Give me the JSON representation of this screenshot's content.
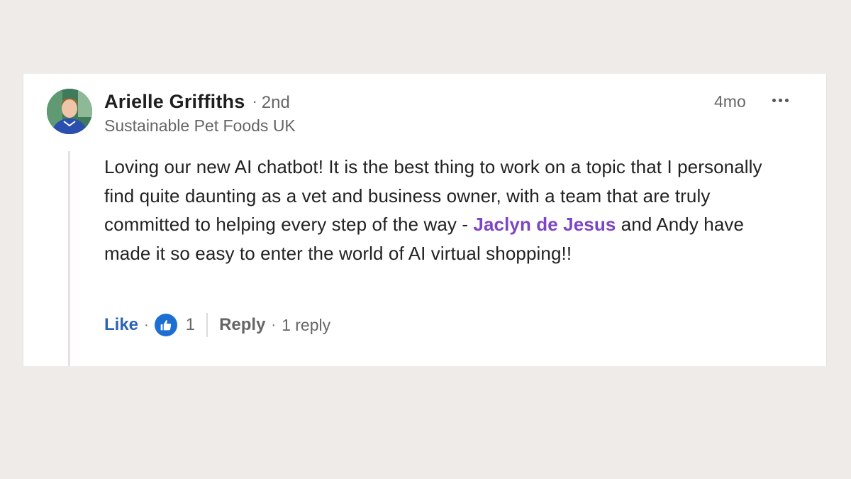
{
  "comment": {
    "author": "Arielle Griffiths",
    "degree_separator": "·",
    "degree": "2nd",
    "headline": "Sustainable Pet Foods UK",
    "time": "4mo",
    "text_before_mention": "Loving our new AI chatbot! It is the best thing to work on a topic that I personally find quite daunting as a vet and business owner, with a team that are truly committed to helping every step of the way - ",
    "mention": "Jaclyn de Jesus",
    "text_after_mention": " and Andy have made it so easy to enter the world of AI virtual shopping!!"
  },
  "actions": {
    "like_label": "Like",
    "like_separator": "·",
    "reaction_count": "1",
    "reply_label": "Reply",
    "reply_separator": "·",
    "reply_count_label": "1 reply"
  },
  "colors": {
    "page_background": "#efebe9",
    "card_background": "#ffffff",
    "mention": "#7b45c4",
    "like_text": "#2b64b6",
    "like_icon": "#1d6ed3"
  },
  "icons": {
    "more": "more-options-icon",
    "reaction": "thumbs-up-icon"
  }
}
